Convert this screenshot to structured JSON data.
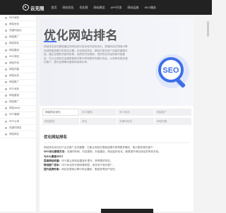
{
  "brand": {
    "name": "云无限"
  },
  "nav": [
    "首页",
    "网站优化",
    "优化营",
    "网站建设",
    "APP开发",
    "网站运维",
    "SEO服务"
  ],
  "sidebar": [
    "SEO优化",
    "网站优化",
    "关键词优化",
    "网站推广",
    "网站排名",
    "网站建设",
    "SEO排名",
    "网站外包",
    "网站托管",
    "网站优化",
    "网站推广",
    "SEO优化",
    "网站建设",
    "网站推广",
    "网站alone",
    "SEO营销",
    "SEO公司",
    "关键词排名",
    "网站排名"
  ],
  "hero": {
    "title": "优化网站排名",
    "text": "网站排名优化是指通过对网站进行技术及内容的优化，提高网站在搜索引擎自然搜索结果中的排名位置。优化网站排名，是吸引更多用户流量的重要手段。通过合理的关键词布局、优质的内容更新、良好的站内结构和外链建设，可以让网站在百度等搜索引擎中获得更好的展示机会，从而带来更多潜在客户，提升品牌曝光度和网站转化率。"
  },
  "seo_badge": "SEO",
  "chips": [
    "网站排名优化",
    "SEO营销",
    "SEO优化",
    "网站推广",
    "网站建设",
    "排名",
    "关键词优化",
    "网站托管"
  ],
  "article": {
    "heading": "优化网站排名",
    "p1": "网站排名优化对于企业推广至关重要，它能让网站在搜索结果中获得更多曝光，吸引更多潜在客户。",
    "p2_label": "SEO优化营销方法：",
    "p2": "关键词布局、内容更新、外链建设、网站结构优化，都是提升网站排名的有效手段。",
    "p3_label": "为什么要做SEO？",
    "p4_label": "提高网站权重：",
    "p4": "SEO能让网站权重逐步提升，获得更好排名。",
    "p5_label": "降低推广成本：",
    "p5": "SEO优化的长期效果明显，成本低于竞价推广。",
    "p6_label": "提升品牌形象：",
    "p6": "网站在搜索引擎中排名靠前，更能获得用户信任。"
  }
}
